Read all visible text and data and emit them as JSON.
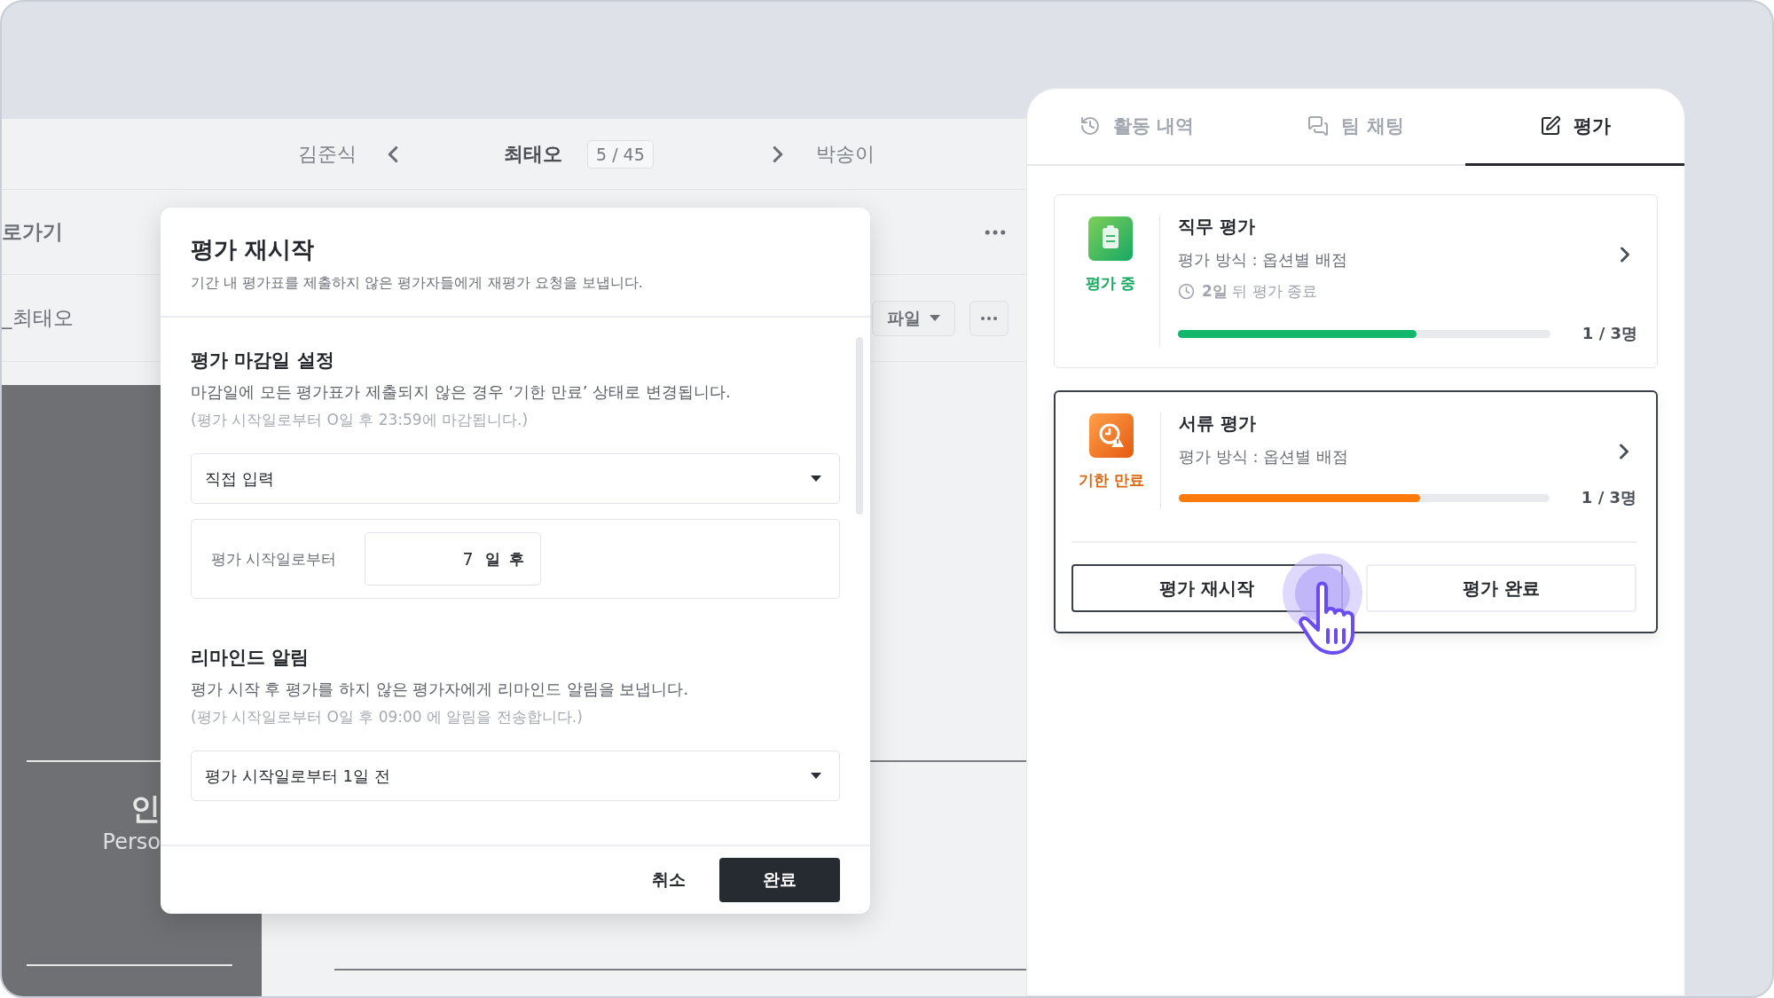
{
  "nav": {
    "prev": "김준식",
    "current": "최태오",
    "counter": "5 / 45",
    "next": "박송이"
  },
  "page": {
    "back_link": "로가기",
    "file_name": "_최태오",
    "file_button": "파일",
    "profile_initial": "인",
    "profile_subtitle": "Perso"
  },
  "dialog": {
    "title": "평가 재시작",
    "subtitle": "기간 내 평가표를 제출하지 않은 평가자들에게 재평가 요청을 보냅니다.",
    "sections": [
      {
        "kind": "deadline",
        "title": "평가 마감일 설정",
        "description": "마감일에 모든 평가표가 제출되지 않은 경우 ‘기한 만료’ 상태로 변경됩니다.",
        "note": "(평가 시작일로부터 O일 후 23:59에 마감됩니다.)",
        "select": "직접 입력",
        "offset_label": "평가 시작일로부터",
        "offset_value": "7",
        "offset_unit": "일 후"
      },
      {
        "kind": "reminder",
        "title": "리마인드 알림",
        "description": "평가 시작 후 평가를 하지 않은 평가자에게 리마인드 알림을 보냅니다.",
        "note": "(평가 시작일로부터 O일 후 09:00 에 알림을 전송합니다.)",
        "select": "평가 시작일로부터 1일 전"
      }
    ],
    "buttons": [
      {
        "label": "취소",
        "kind": "text"
      },
      {
        "label": "완료",
        "kind": "primary"
      }
    ]
  },
  "panel": {
    "tabs": [
      {
        "label": "활동 내역",
        "selected": false
      },
      {
        "label": "팀 채팅",
        "selected": false
      },
      {
        "label": "평가",
        "selected": true
      }
    ],
    "evaluations": [
      {
        "title": "직무 평가",
        "status": "평가 중",
        "kind": "progress",
        "method": "평가 방식 : 옵션별 배점",
        "deadline": "**2일** 뒤 평가 종료",
        "level": 0.64,
        "count": "1 / 3명",
        "selected": false
      },
      {
        "title": "서류 평가",
        "status": "기한 만료",
        "kind": "expired",
        "method": "평가 방식 : 옵션별 배점",
        "level": 0.65,
        "count": "1 / 3명",
        "selected": true,
        "actions": [
          {
            "label": "평가 재시작",
            "kind": "outline"
          },
          {
            "label": "평가 완료",
            "kind": "plain"
          }
        ]
      }
    ]
  }
}
